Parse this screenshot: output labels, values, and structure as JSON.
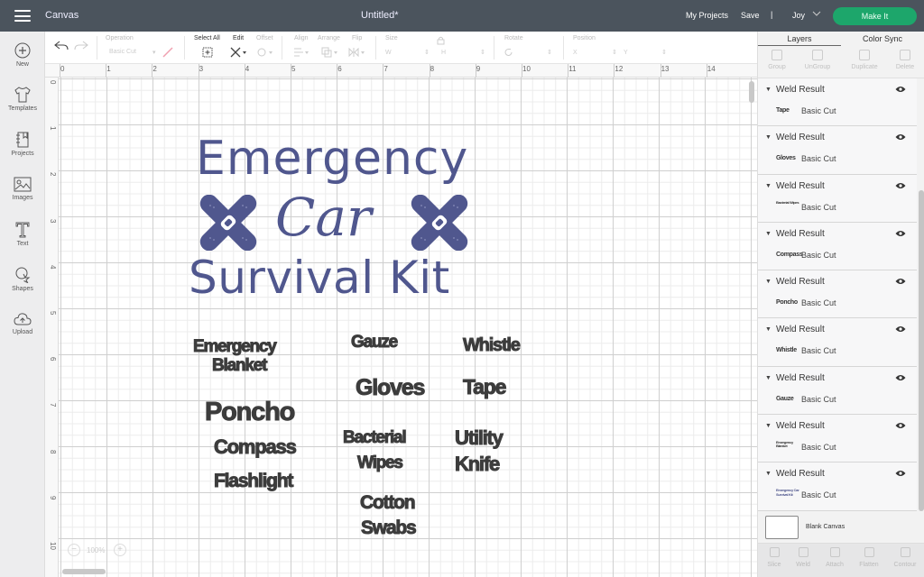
{
  "topbar": {
    "app_name": "Canvas",
    "doc_title": "Untitled*",
    "my_projects": "My Projects",
    "save": "Save",
    "separator": "|",
    "user": "Joy",
    "make_it": "Make It",
    "accent_color": "#1da66b"
  },
  "leftnav": {
    "items": [
      {
        "label": "New",
        "icon": "plus-circle-icon"
      },
      {
        "label": "Templates",
        "icon": "tshirt-icon"
      },
      {
        "label": "Projects",
        "icon": "notebook-icon"
      },
      {
        "label": "Images",
        "icon": "image-icon"
      },
      {
        "label": "Text",
        "icon": "text-t-icon"
      },
      {
        "label": "Shapes",
        "icon": "shapes-icon"
      },
      {
        "label": "Upload",
        "icon": "cloud-upload-icon"
      }
    ]
  },
  "toolbar": {
    "operation_label": "Operation",
    "operation_value": "Basic Cut",
    "select_all": "Select All",
    "edit": "Edit",
    "offset": "Offset",
    "align": "Align",
    "arrange": "Arrange",
    "flip": "Flip",
    "size": "Size",
    "w": "W",
    "h": "H",
    "rotate": "Rotate",
    "position": "Position",
    "x": "X",
    "y": "Y"
  },
  "rulers": {
    "top": [
      "0",
      "1",
      "2",
      "3",
      "4",
      "5",
      "6",
      "7",
      "8",
      "9",
      "10",
      "11",
      "12",
      "13",
      "14"
    ],
    "left": [
      "0",
      "1",
      "2",
      "3",
      "4",
      "5",
      "6",
      "7",
      "8",
      "9",
      "10"
    ]
  },
  "zoom": {
    "level": "100%",
    "minus": "−",
    "plus": "+"
  },
  "design": {
    "title_line1": "Emergency",
    "title_line2": "Car",
    "title_line3": "Survival Kit",
    "title_color": "#50578e",
    "word_color": "#3c3c3c",
    "words": {
      "emergency_blanket_1": "Emergency",
      "emergency_blanket_2": "Blanket",
      "gauze": "Gauze",
      "whistle": "Whistle",
      "gloves": "Gloves",
      "tape": "Tape",
      "poncho": "Poncho",
      "compass": "Compass",
      "flashlight": "Flashlight",
      "bacterial_1": "Bacterial",
      "bacterial_2": "Wipes",
      "utility_1": "Utility",
      "utility_2": "Knife",
      "cotton_1": "Cotton",
      "cotton_2": "Swabs"
    }
  },
  "panel": {
    "tabs": [
      "Layers",
      "Color Sync"
    ],
    "actions": [
      "Group",
      "UnGroup",
      "Duplicate",
      "Delete"
    ],
    "layers": [
      {
        "name": "Weld Result",
        "thumb": "Tape",
        "type": "Basic Cut"
      },
      {
        "name": "Weld Result",
        "thumb": "Gloves",
        "type": "Basic Cut"
      },
      {
        "name": "Weld Result",
        "thumb": "Bacterial Wipes",
        "type": "Basic Cut"
      },
      {
        "name": "Weld Result",
        "thumb": "Compass",
        "type": "Basic Cut"
      },
      {
        "name": "Weld Result",
        "thumb": "Poncho",
        "type": "Basic Cut"
      },
      {
        "name": "Weld Result",
        "thumb": "Whistle",
        "type": "Basic Cut"
      },
      {
        "name": "Weld Result",
        "thumb": "Gauze",
        "type": "Basic Cut"
      },
      {
        "name": "Weld Result",
        "thumb": "Emergency Blanket",
        "type": "Basic Cut"
      },
      {
        "name": "Weld Result",
        "thumb": "Emergency Car Survival Kit",
        "type": "Basic Cut"
      }
    ],
    "blank_canvas": "Blank Canvas",
    "bottom_actions": [
      "Slice",
      "Weld",
      "Attach",
      "Flatten",
      "Contour"
    ]
  }
}
